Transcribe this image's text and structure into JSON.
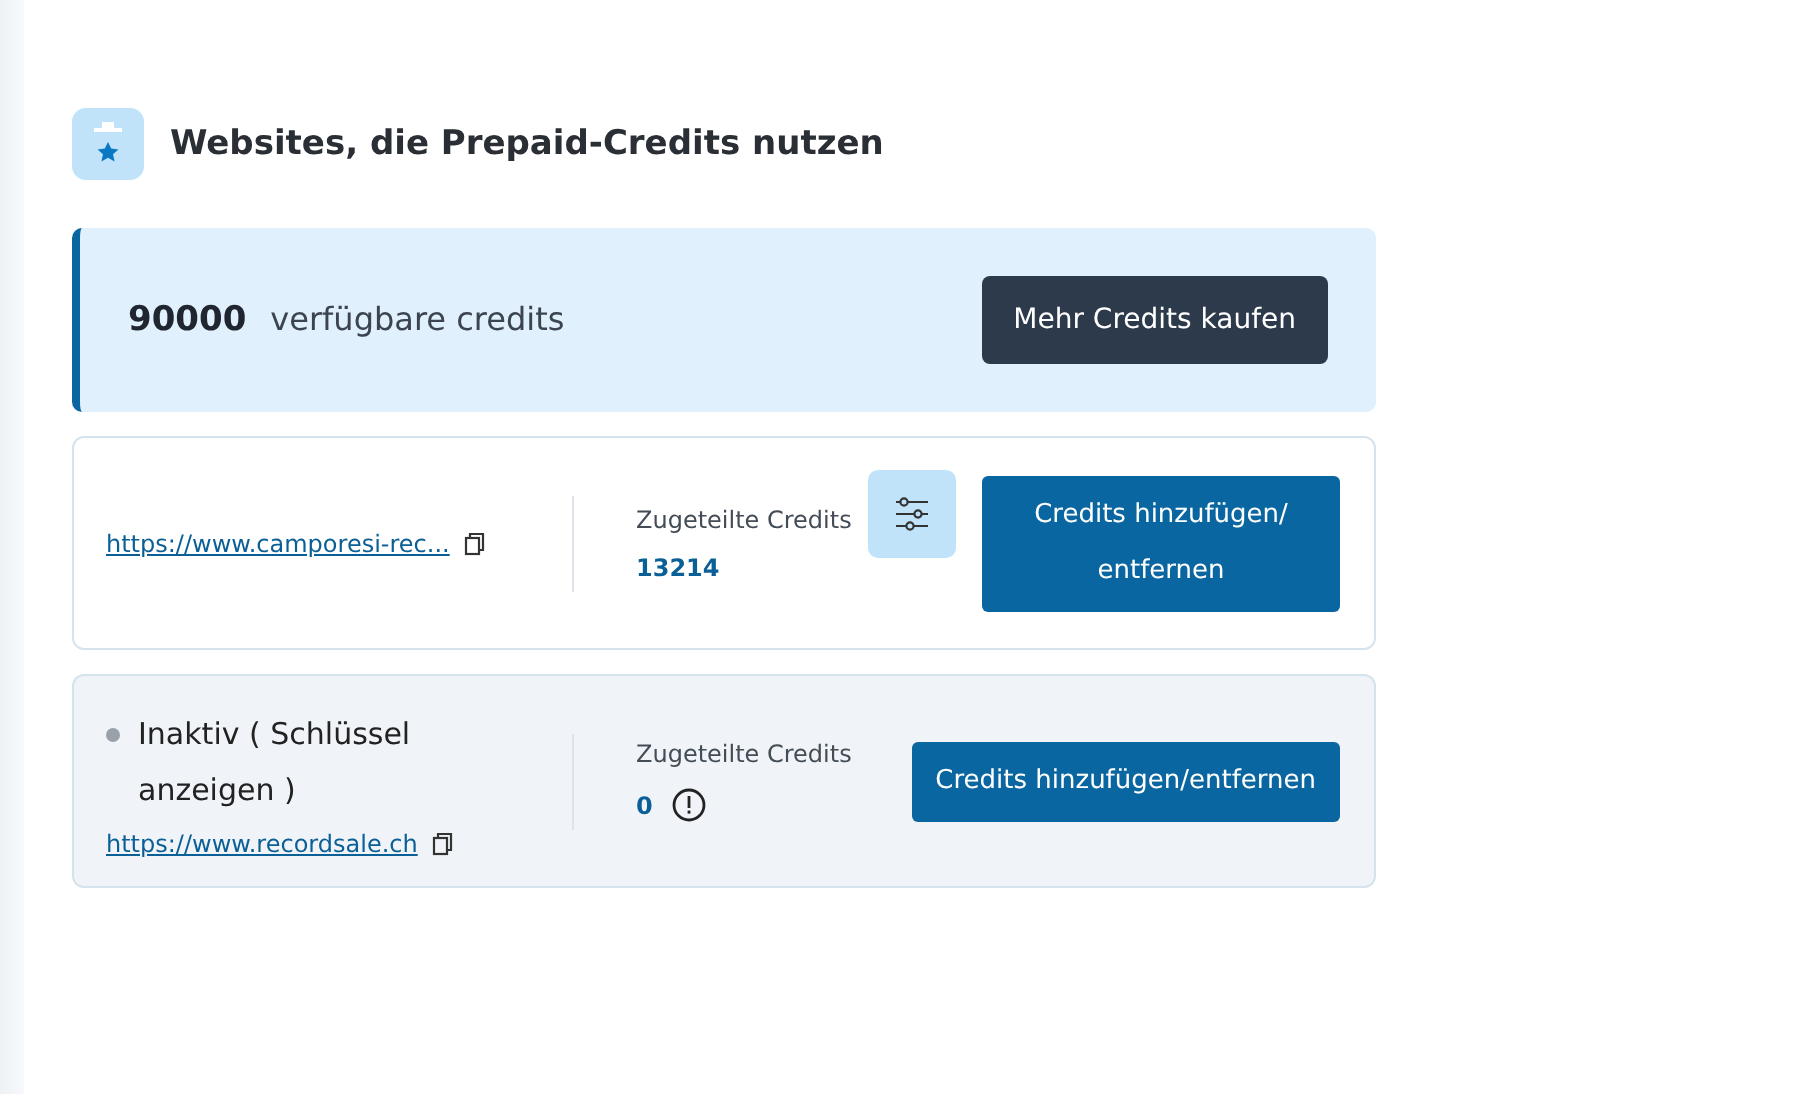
{
  "section": {
    "title": "Websites, die Prepaid-Credits nutzen"
  },
  "balance": {
    "amount": "90000",
    "label": "verfügbare credits",
    "button": "Mehr Credits kaufen"
  },
  "sites": [
    {
      "active": true,
      "url": "https://www.camporesi-rec...",
      "credits_label": "Zugeteilte Credits",
      "credits": "13214",
      "warning": false,
      "settings_button": true,
      "button": "Credits hinzufügen/ entfernen"
    },
    {
      "active": false,
      "status": "Inaktiv ( Schlüssel anzeigen )",
      "url": "https://www.recordsale.ch",
      "credits_label": "Zugeteilte Credits",
      "credits": "0",
      "warning": true,
      "settings_button": false,
      "button": "Credits hinzufügen/entfernen"
    }
  ]
}
